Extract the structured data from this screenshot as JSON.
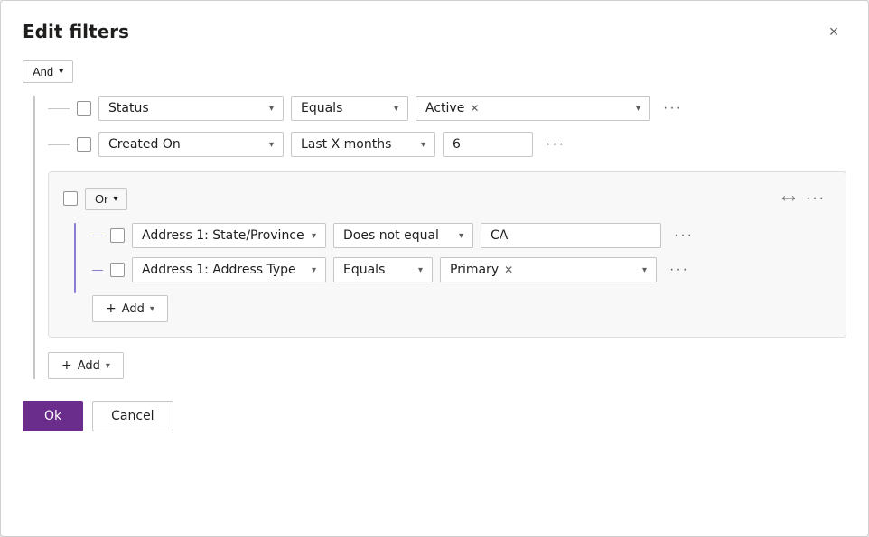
{
  "dialog": {
    "title": "Edit filters",
    "close_label": "×"
  },
  "and_group": {
    "label": "And",
    "chevron": "▾"
  },
  "filter_rows": [
    {
      "id": "row-status",
      "field": "Status",
      "operator": "Equals",
      "value_tag": "Active",
      "more": "···"
    },
    {
      "id": "row-created-on",
      "field": "Created On",
      "operator": "Last X months",
      "value_text": "6",
      "more": "···"
    }
  ],
  "or_group": {
    "label": "Or",
    "chevron": "▾",
    "collapse_icon": "⤢",
    "more": "···",
    "inner_rows": [
      {
        "id": "or-row-state",
        "field": "Address 1: State/Province",
        "operator": "Does not equal",
        "value_text": "CA",
        "more": "···"
      },
      {
        "id": "or-row-address-type",
        "field": "Address 1: Address Type",
        "operator": "Equals",
        "value_tag": "Primary",
        "more": "···"
      }
    ],
    "add_label": "Add",
    "add_chevron": "▾"
  },
  "add_label": "Add",
  "add_chevron": "▾",
  "footer": {
    "ok_label": "Ok",
    "cancel_label": "Cancel"
  }
}
